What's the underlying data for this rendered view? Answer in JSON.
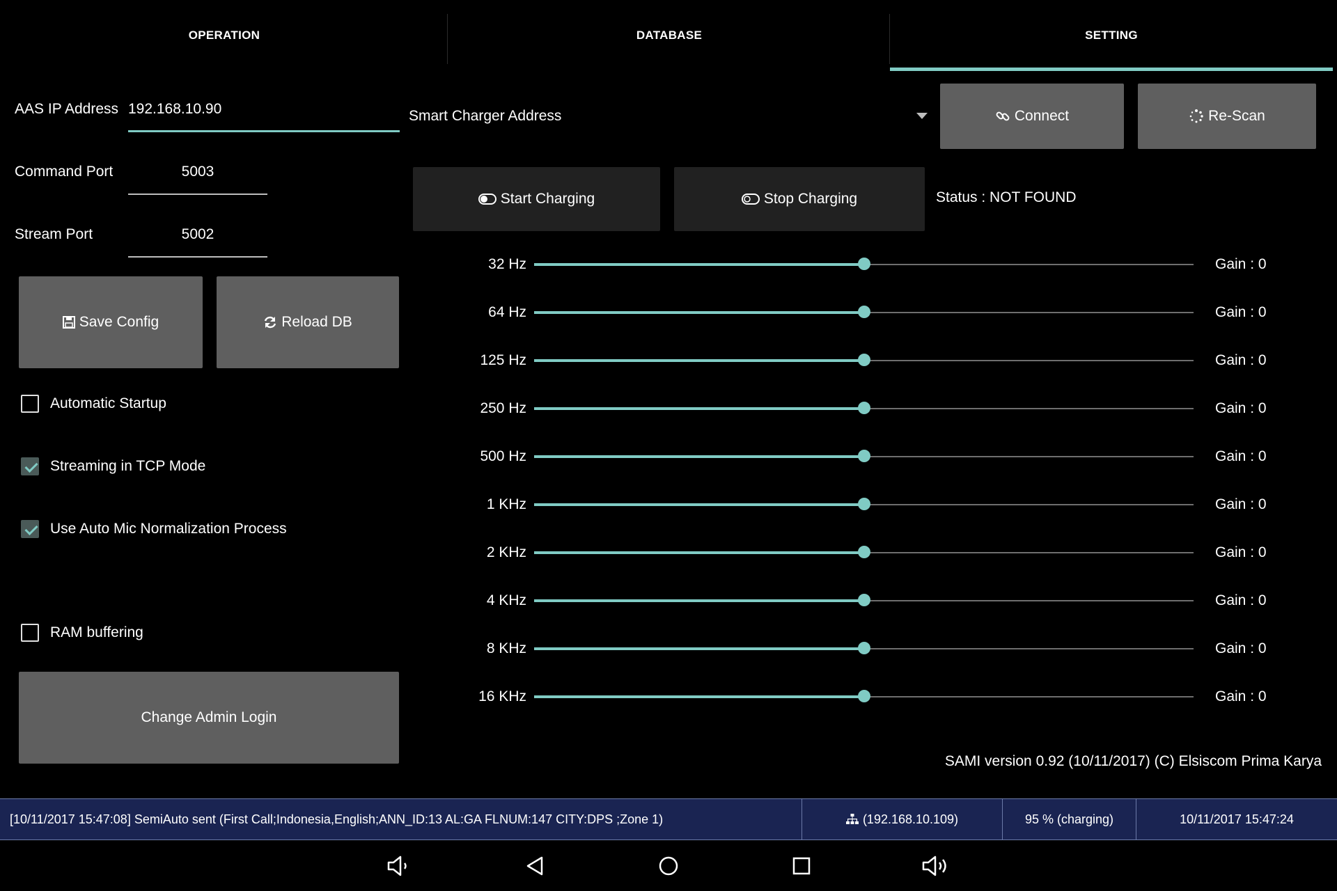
{
  "tabs": [
    {
      "label": "OPERATION"
    },
    {
      "label": "DATABASE"
    },
    {
      "label": "SETTING"
    }
  ],
  "form": {
    "ip_label": "AAS IP Address",
    "ip_value": "192.168.10.90",
    "command_port_label": "Command Port",
    "command_port_value": "5003",
    "stream_port_label": "Stream Port",
    "stream_port_value": "5002"
  },
  "buttons": {
    "save_config": "Save Config",
    "reload_db": "Reload DB",
    "change_admin_login": "Change Admin Login",
    "connect": "Connect",
    "rescan": "Re-Scan",
    "start_charging": "Start Charging",
    "stop_charging": "Stop Charging"
  },
  "checkboxes": [
    {
      "label": "Automatic Startup",
      "checked": false
    },
    {
      "label": "Streaming in TCP Mode",
      "checked": true
    },
    {
      "label": "Use Auto Mic Normalization Process",
      "checked": true
    },
    {
      "label": "RAM buffering",
      "checked": false
    }
  ],
  "charger": {
    "dropdown_selected": "Smart Charger Address",
    "status": "Status : NOT FOUND"
  },
  "equalizer": [
    {
      "band": "32 Hz",
      "gain": "Gain : 0",
      "level": 0.5
    },
    {
      "band": "64 Hz",
      "gain": "Gain : 0",
      "level": 0.5
    },
    {
      "band": "125 Hz",
      "gain": "Gain : 0",
      "level": 0.5
    },
    {
      "band": "250 Hz",
      "gain": "Gain : 0",
      "level": 0.5
    },
    {
      "band": "500 Hz",
      "gain": "Gain : 0",
      "level": 0.5
    },
    {
      "band": "1 KHz",
      "gain": "Gain : 0",
      "level": 0.5
    },
    {
      "band": "2 KHz",
      "gain": "Gain : 0",
      "level": 0.5
    },
    {
      "band": "4 KHz",
      "gain": "Gain : 0",
      "level": 0.5
    },
    {
      "band": "8 KHz",
      "gain": "Gain : 0",
      "level": 0.5
    },
    {
      "band": "16 KHz",
      "gain": "Gain : 0",
      "level": 0.5
    }
  ],
  "version": "SAMI version 0.92 (10/11/2017) (C) Elsiscom Prima Karya",
  "statusbar": {
    "log": "[10/11/2017 15:47:08] SemiAuto sent (First Call;Indonesia,English;ANN_ID:13 AL:GA FLNUM:147 CITY:DPS ;Zone 1)",
    "network": "(192.168.10.109)",
    "battery": "95 % (charging)",
    "datetime": "10/11/2017  15:47:24"
  },
  "colors": {
    "accent": "#80cbc4",
    "button_bg": "#5f5f5f",
    "statusbar_bg": "#1a2452"
  }
}
